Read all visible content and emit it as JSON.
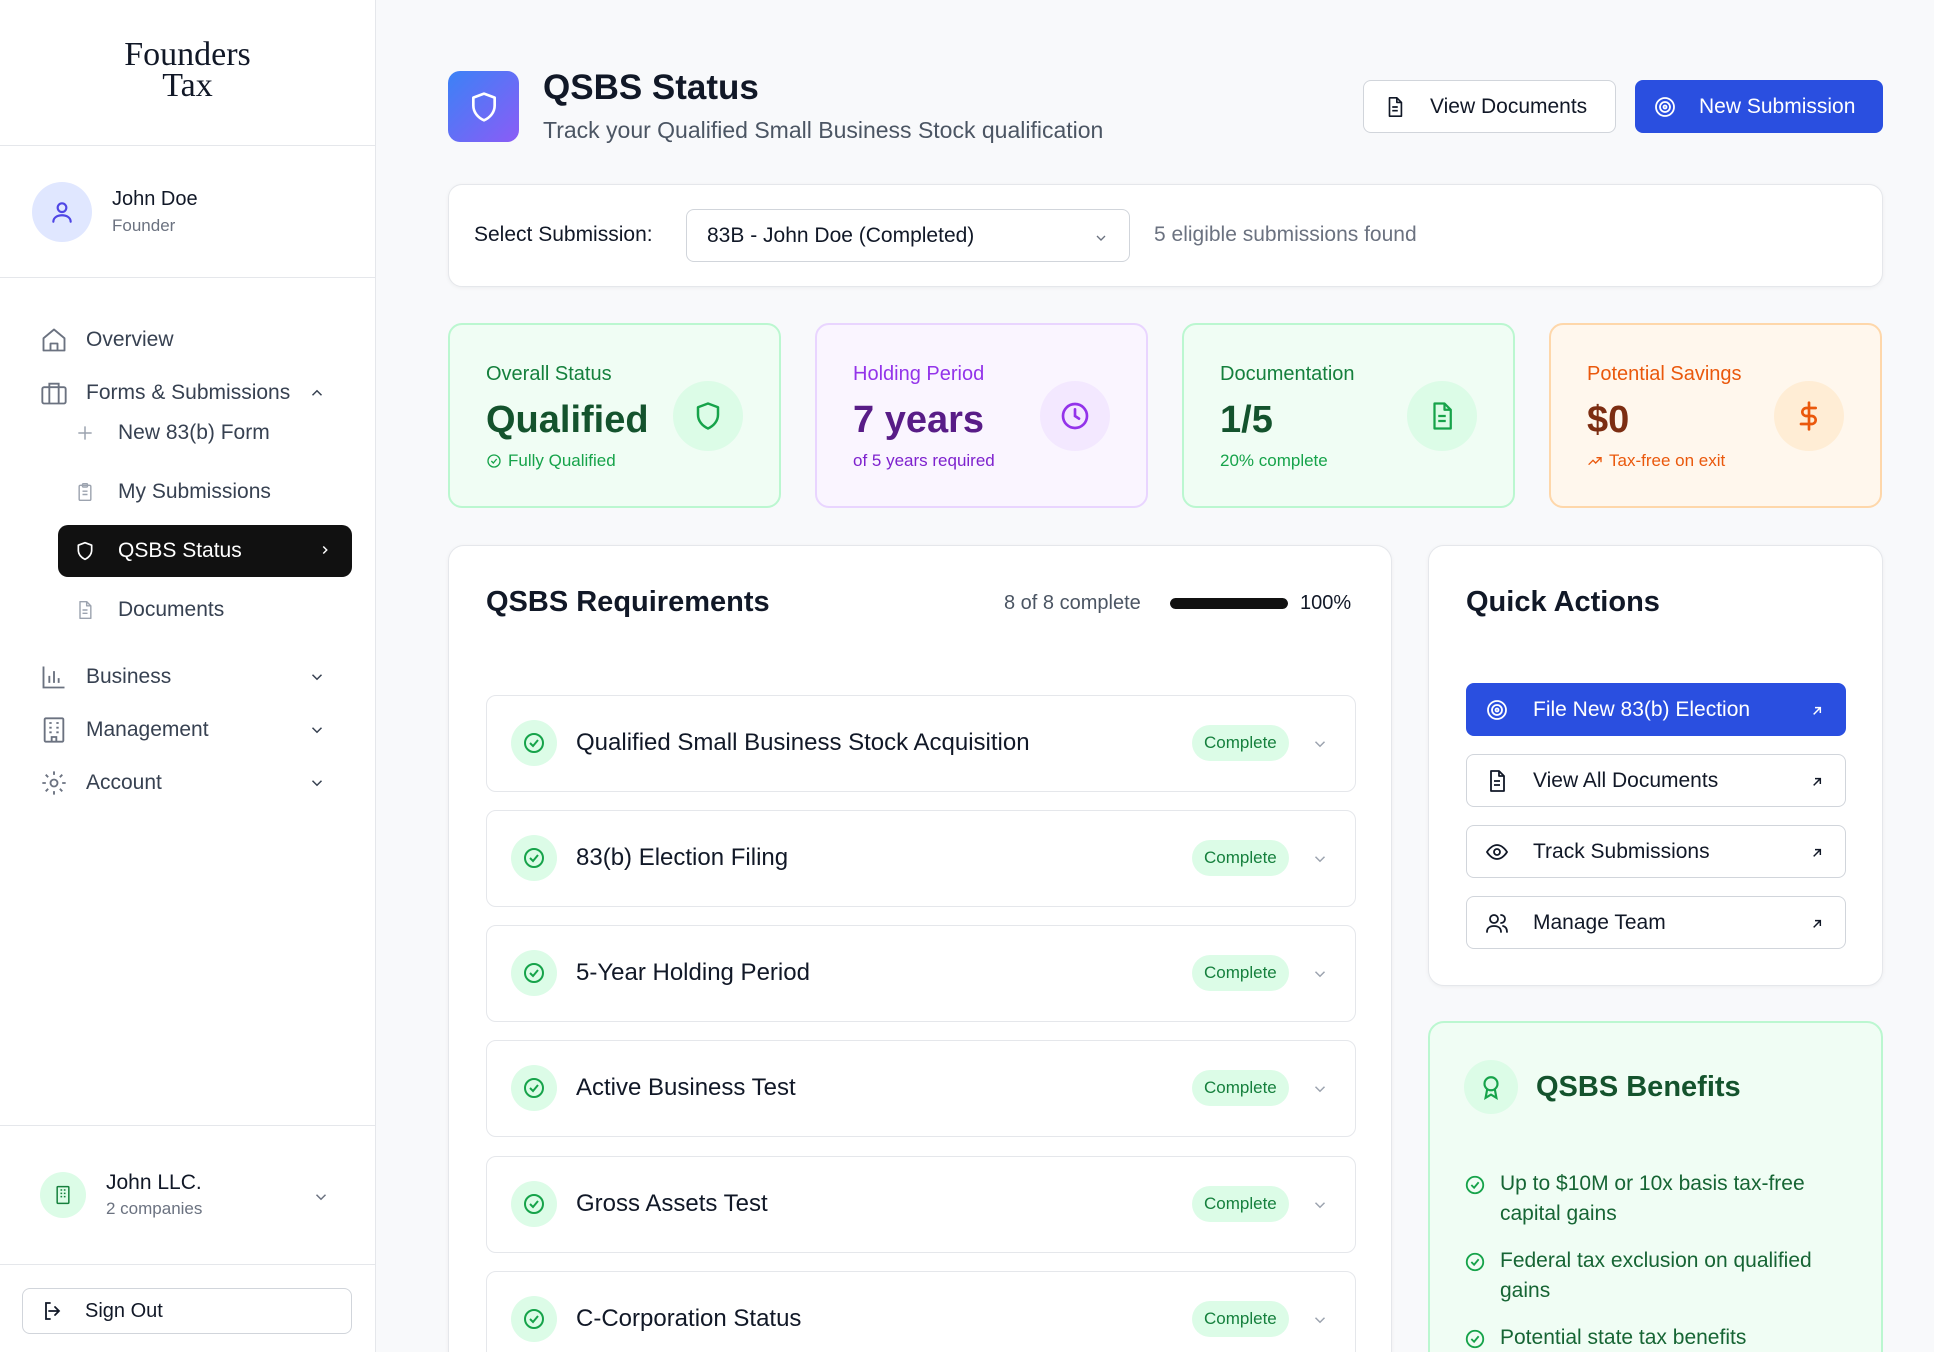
{
  "brand": {
    "line1": "Founders",
    "line2": "Tax"
  },
  "user": {
    "name": "John Doe",
    "role": "Founder"
  },
  "nav": {
    "overview": "Overview",
    "forms": "Forms & Submissions",
    "new_form": "New 83(b) Form",
    "my_submissions": "My Submissions",
    "qsbs_status": "QSBS Status",
    "documents": "Documents",
    "business": "Business",
    "management": "Management",
    "account": "Account"
  },
  "company": {
    "name": "John LLC.",
    "sub": "2 companies"
  },
  "signout": "Sign Out",
  "header": {
    "title": "QSBS Status",
    "subtitle": "Track your Qualified Small Business Stock qualification",
    "view_documents": "View Documents",
    "new_submission": "New Submission"
  },
  "select": {
    "label": "Select Submission:",
    "value": "83B - John Doe (Completed)",
    "count": "5 eligible submissions found"
  },
  "stats": [
    {
      "label": "Overall Status",
      "value": "Qualified",
      "sub": "Fully Qualified",
      "icon": "shield-icon",
      "color": "#15803d"
    },
    {
      "label": "Holding Period",
      "value": "7 years",
      "sub": "of 5 years required",
      "icon": "clock-icon",
      "color": "#7e22ce"
    },
    {
      "label": "Documentation",
      "value": "1/5",
      "sub": "20% complete",
      "icon": "document-icon",
      "color": "#15803d"
    },
    {
      "label": "Potential Savings",
      "value": "$0",
      "sub": "Tax-free on exit",
      "icon": "dollar-icon",
      "color": "#c2410c"
    }
  ],
  "requirements": {
    "title": "QSBS Requirements",
    "progress_text": "8 of 8 complete",
    "progress": 1.0,
    "percent": "100%",
    "items": [
      {
        "name": "Qualified Small Business Stock Acquisition",
        "status": "Complete"
      },
      {
        "name": "83(b) Election Filing",
        "status": "Complete"
      },
      {
        "name": "5-Year Holding Period",
        "status": "Complete"
      },
      {
        "name": "Active Business Test",
        "status": "Complete"
      },
      {
        "name": "Gross Assets Test",
        "status": "Complete"
      },
      {
        "name": "C-Corporation Status",
        "status": "Complete"
      }
    ]
  },
  "quick_actions": {
    "title": "Quick Actions",
    "items": [
      {
        "label": "File New 83(b) Election",
        "icon": "target-icon"
      },
      {
        "label": "View All Documents",
        "icon": "document-icon"
      },
      {
        "label": "Track Submissions",
        "icon": "eye-icon"
      },
      {
        "label": "Manage Team",
        "icon": "users-icon"
      }
    ]
  },
  "benefits": {
    "title": "QSBS Benefits",
    "items": [
      "Up to $10M or 10x basis tax-free capital gains",
      "Federal tax exclusion on qualified gains",
      "Potential state tax benefits"
    ]
  },
  "colors": {
    "primary": "#2a4fe0",
    "success": "#15803d",
    "purple": "#7e22ce",
    "orange": "#c2410c"
  }
}
